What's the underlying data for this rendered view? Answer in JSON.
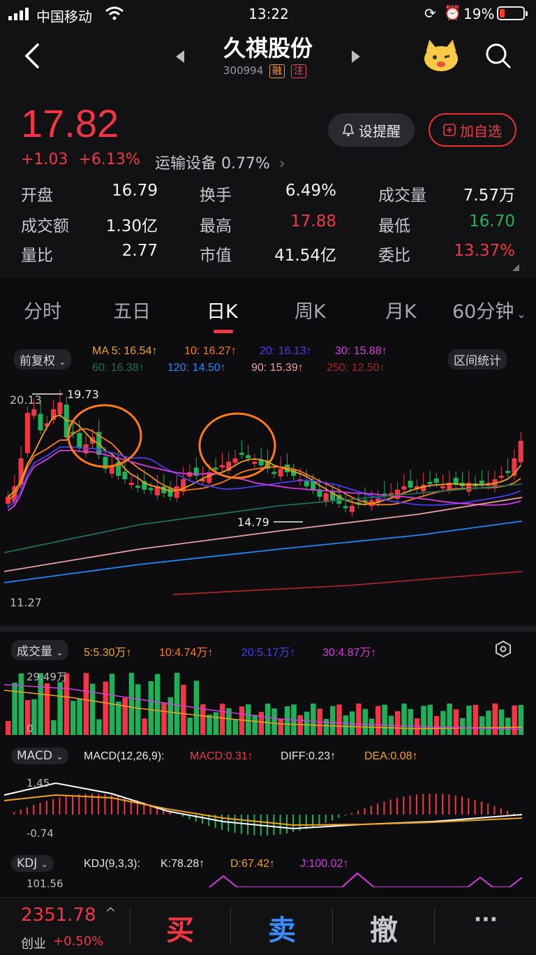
{
  "status_bar": {
    "carrier": "中国移动",
    "time": "13:22",
    "battery": "19%"
  },
  "header": {
    "title": "久祺股份",
    "code": "300994",
    "tag_margin": "融",
    "tag_watch": "注"
  },
  "quote": {
    "price": "17.82",
    "change": "+1.03",
    "change_pct": "+6.13%",
    "sector": "运输设备 0.77%",
    "alert_button": "设提醒",
    "fav_button": "加自选",
    "stats": [
      {
        "label": "开盘",
        "value": "16.79"
      },
      {
        "label": "换手",
        "value": "6.49%"
      },
      {
        "label": "成交量",
        "value": "7.57万"
      },
      {
        "label": "成交额",
        "value": "1.30亿"
      },
      {
        "label": "最高",
        "value": "17.88"
      },
      {
        "label": "最低",
        "value": "16.70"
      },
      {
        "label": "量比",
        "value": "2.77"
      },
      {
        "label": "市值",
        "value": "41.54亿"
      },
      {
        "label": "委比",
        "value": "13.37%"
      }
    ]
  },
  "tabs": [
    "分时",
    "五日",
    "日K",
    "周K",
    "月K",
    "60分钟"
  ],
  "kline": {
    "adjust_label": "前复权",
    "interval_stats": "区间统计",
    "ma_row1": [
      "MA 5: 16.54↑",
      "10: 16.27↑",
      "20: 16.13↑",
      "30: 15.88↑"
    ],
    "ma_row2": [
      "60: 16.38↑",
      "120: 14.50↑",
      "90: 15.39↑",
      "250: 12.50↑"
    ],
    "y_top": "20.13",
    "y_bottom": "11.27",
    "high_mark": "19.73",
    "low_mark": "14.79"
  },
  "volume": {
    "label": "成交量",
    "ma": [
      "5:5.30万↑",
      "10:4.74万↑",
      "20:5.17万↑",
      "30:4.87万↑"
    ],
    "y_top": "29.49万",
    "y_bottom": "0"
  },
  "macd": {
    "label": "MACD",
    "params": "MACD(12,26,9):",
    "values": [
      "MACD:0.31↑",
      "DIFF:0.23↑",
      "DEA:0.08↑"
    ],
    "y_top": "1.45",
    "y_bottom": "-0.74"
  },
  "kdj": {
    "label": "KDJ",
    "params": "KDJ(9,3,3):",
    "values": [
      "K:78.28↑",
      "D:67.42↑",
      "J:100.02↑"
    ],
    "y_top": "101.56"
  },
  "bottom_bar": {
    "index_value": "2351.78",
    "index_name": "创业",
    "index_change": "+0.50%",
    "buy": "买",
    "sell": "卖",
    "cancel": "撤",
    "more": "···"
  },
  "colors": {
    "up": "#f23645",
    "down": "#1fb15a",
    "ma5": "#f2a31c",
    "ma10": "#ff7a1a",
    "ma20": "#4b3cf0",
    "ma30": "#d63be0",
    "ma60": "#1f6e5a",
    "ma120": "#1e88ff",
    "ma90": "#e8a0a0",
    "ma250": "#a82323"
  }
}
